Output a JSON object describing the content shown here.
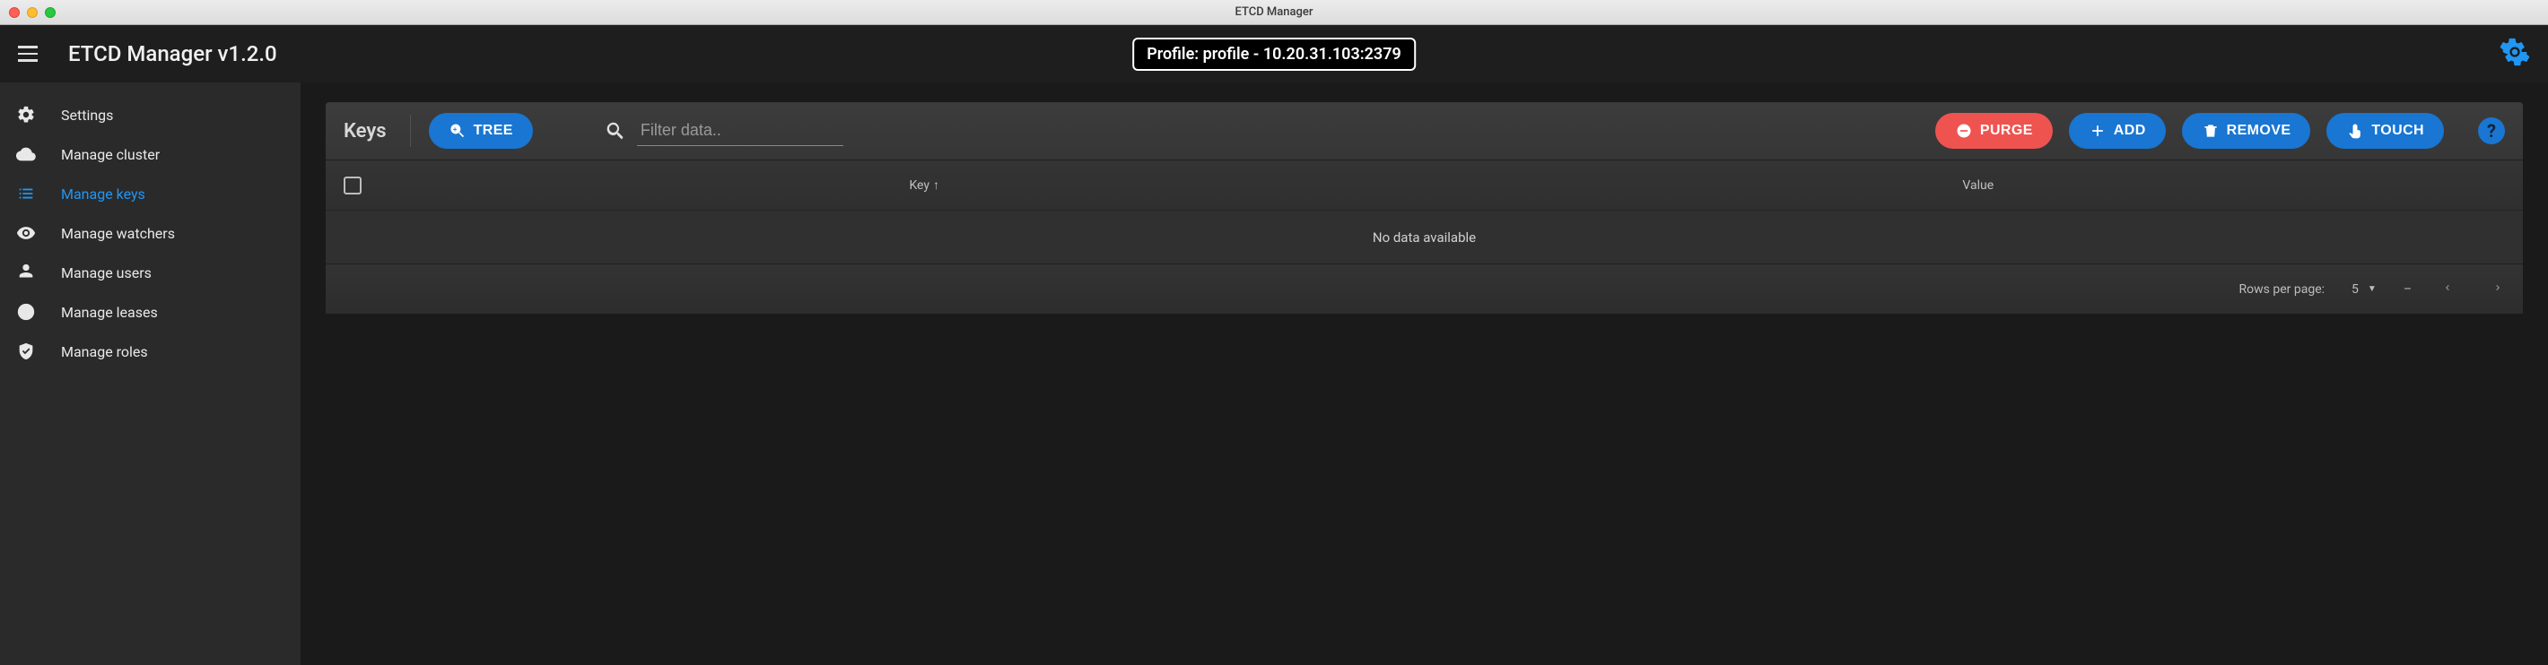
{
  "window": {
    "title": "ETCD Manager"
  },
  "header": {
    "app_title": "ETCD Manager v1.2.0",
    "profile_text": "Profile: profile - 10.20.31.103:2379"
  },
  "sidebar": {
    "items": [
      {
        "label": "Settings",
        "icon": "settings-gear-icon",
        "active": false
      },
      {
        "label": "Manage cluster",
        "icon": "cloud-icon",
        "active": false
      },
      {
        "label": "Manage keys",
        "icon": "list-icon",
        "active": true
      },
      {
        "label": "Manage watchers",
        "icon": "eye-icon",
        "active": false
      },
      {
        "label": "Manage users",
        "icon": "user-icon",
        "active": false
      },
      {
        "label": "Manage leases",
        "icon": "clock-icon",
        "active": false
      },
      {
        "label": "Manage roles",
        "icon": "shield-check-icon",
        "active": false
      }
    ]
  },
  "toolbar": {
    "section_title": "Keys",
    "tree_label": "TREE",
    "search_placeholder": "Filter data..",
    "purge_label": "PURGE",
    "add_label": "ADD",
    "remove_label": "REMOVE",
    "touch_label": "TOUCH",
    "help_label": "?"
  },
  "table": {
    "columns": {
      "key": "Key",
      "value": "Value"
    },
    "sort": {
      "column": "key",
      "direction": "asc"
    },
    "rows": [],
    "empty_text": "No data available"
  },
  "pagination": {
    "rows_per_page_label": "Rows per page:",
    "rows_per_page_value": "5",
    "range_text": "–"
  },
  "colors": {
    "accent": "#1976d2",
    "danger": "#ef5350"
  }
}
